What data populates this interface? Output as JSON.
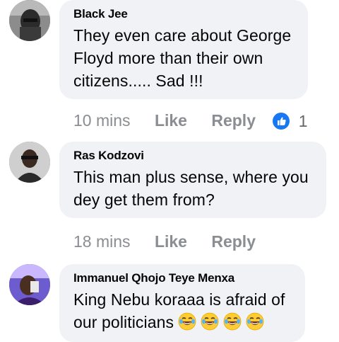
{
  "comments": [
    {
      "name": "Black Jee",
      "text_lines": [
        "They even care about George",
        "Floyd more than their own",
        "citizens..... Sad !!!"
      ],
      "time": "10 mins",
      "like_label": "Like",
      "reply_label": "Reply",
      "reaction_icon": "like-thumb-icon",
      "reaction_count": "1"
    },
    {
      "name": "Ras Kodzovi",
      "text_lines": [
        "This man plus sense, where you",
        "dey get them from?"
      ],
      "time": "18 mins",
      "like_label": "Like",
      "reply_label": "Reply"
    },
    {
      "name": "Immanuel Qhojo Teye Menxa",
      "text_lines": [
        "King Nebu koraaa is afraid of",
        "our politicians"
      ],
      "emoji": [
        "crying-laughing-emoji",
        "crying-laughing-emoji",
        "crying-laughing-emoji",
        "crying-laughing-emoji"
      ]
    }
  ],
  "colors": {
    "bubble": "#f0f2f5",
    "meta_text": "#8a8d91",
    "like_blue": "#1877f2"
  }
}
